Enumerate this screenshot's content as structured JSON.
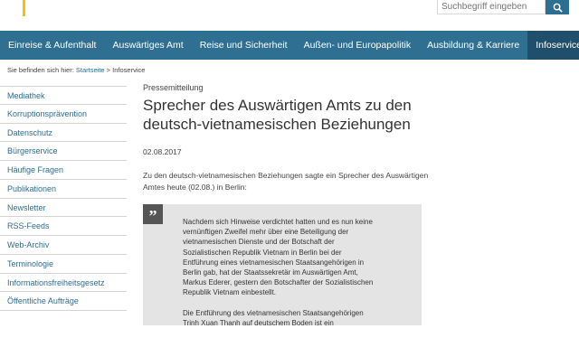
{
  "search": {
    "placeholder": "Suchbegriff eingeben"
  },
  "nav": [
    {
      "label": "Einreise & Aufenthalt"
    },
    {
      "label": "Auswärtiges Amt"
    },
    {
      "label": "Reise und Sicherheit"
    },
    {
      "label": "Außen- und Europapolitik"
    },
    {
      "label": "Ausbildung & Karriere"
    },
    {
      "label": "Infoservice"
    }
  ],
  "breadcrumb": {
    "prefix": "Sie befinden sich hier:",
    "home": "Startseite",
    "separator": ">",
    "current": "Infoservice"
  },
  "sidebar": [
    {
      "label": "Mediathek"
    },
    {
      "label": "Korruptionsprävention"
    },
    {
      "label": "Datenschutz"
    },
    {
      "label": "Bürgerservice"
    },
    {
      "label": "Häufige Fragen"
    },
    {
      "label": "Publikationen"
    },
    {
      "label": "Newsletter"
    },
    {
      "label": "RSS-Feeds"
    },
    {
      "label": "Web-Archiv"
    },
    {
      "label": "Terminologie"
    },
    {
      "label": "Informationsfreiheitsgesetz"
    },
    {
      "label": "Öffentliche Aufträge"
    }
  ],
  "article": {
    "kicker": "Pressemitteilung",
    "title_line1": "Sprecher des Auswärtigen Amts zu den",
    "title_line2": "deutsch-vietnamesischen Beziehungen",
    "date": "02.08.2017",
    "intro_line1": "Zu den deutsch-vietnamesischen Beziehungen sagte ein Sprecher des Auswärtigen",
    "intro_line2": "Amtes heute (02.08.) in Berlin:",
    "quote_mark": "”",
    "quote_p1": [
      "Nachdem sich Hinweise verdichtet hatten und es nun keine",
      "vernünftigen Zweifel mehr über eine Beteiligung der",
      "vietnamesischen Dienste und der Botschaft der",
      "Sozialistischen Republik Vietnam in Berlin bei der",
      "Entführung eines vietnamesischen Staatsangehörigen in",
      "Berlin gab, hat der Staatssekretär im Auswärtigen Amt,",
      "Markus Ederer, gestern den Botschafter der Sozialistischen",
      "Republik Vietnam einbestellt."
    ],
    "quote_p2": [
      "Die Entführung des vietnamesischen Staatsangehörigen",
      "Trinh Xuan Thanh auf deutschem Boden ist ein"
    ]
  },
  "colors": {
    "nav_bg": "#2f6f92",
    "nav_active": "#1f4f6a",
    "link": "#2d6e93",
    "accent": "#f5c400",
    "quote_bg": "#e4e4e4"
  }
}
